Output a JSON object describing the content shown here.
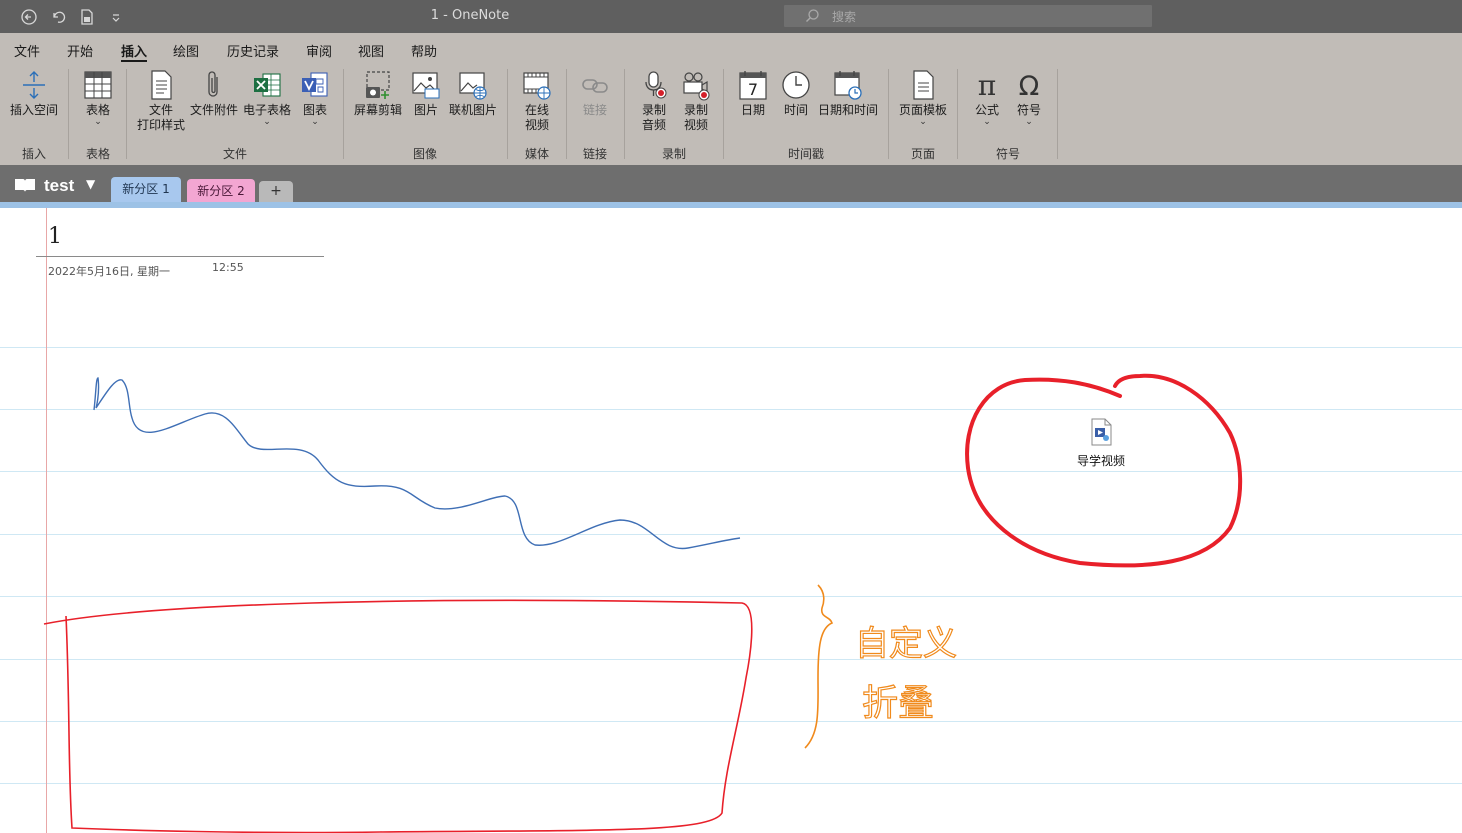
{
  "window": {
    "title": "1  -  OneNote",
    "search_placeholder": "搜索",
    "quick_access": [
      "back-icon",
      "undo-icon",
      "page-icon",
      "customize-icon"
    ]
  },
  "menu": {
    "tabs": [
      "文件",
      "开始",
      "插入",
      "绘图",
      "历史记录",
      "审阅",
      "视图",
      "帮助"
    ],
    "active_tab": "插入"
  },
  "ribbon": {
    "buttons": {
      "insert_space": "插入空间",
      "table": "表格",
      "file_printout_1": "文件",
      "file_printout_2": "打印样式",
      "file_attachment": "文件附件",
      "spreadsheet": "电子表格",
      "chart": "图表",
      "screen_clipping": "屏幕剪辑",
      "picture": "图片",
      "online_picture": "联机图片",
      "online_video_1": "在线",
      "online_video_2": "视频",
      "link": "链接",
      "record_audio_1": "录制",
      "record_audio_2": "音频",
      "record_video_1": "录制",
      "record_video_2": "视频",
      "date": "日期",
      "time": "时间",
      "date_time": "日期和时间",
      "page_templates": "页面模板",
      "equation": "公式",
      "symbol": "符号"
    },
    "groups": {
      "insert": "插入",
      "tables": "表格",
      "files": "文件",
      "images": "图像",
      "media": "媒体",
      "links": "链接",
      "recording": "录制",
      "timestamp": "时间戳",
      "pages": "页面",
      "symbols": "符号"
    },
    "date_icon_text": "7"
  },
  "notebook": {
    "name": "test",
    "sections": [
      {
        "label": "新分区 1",
        "color": "#a8c8ee"
      },
      {
        "label": "新分区 2",
        "color": "#f3a6d2"
      }
    ],
    "add_label": "+"
  },
  "page": {
    "title": "1",
    "date": "2022年5月16日, 星期一",
    "time": "12:55",
    "attachment_label": "导学视频",
    "handwriting_line1": "自定义",
    "handwriting_line2": "折叠"
  },
  "colors": {
    "titlebar": "#5f5f5f",
    "ribbon": "#c1bcb7",
    "sectionbar": "#6e6e6e",
    "ink_blue": "#3f6fb5",
    "ink_red": "#e8202a",
    "ink_orange": "#f08a1c"
  }
}
